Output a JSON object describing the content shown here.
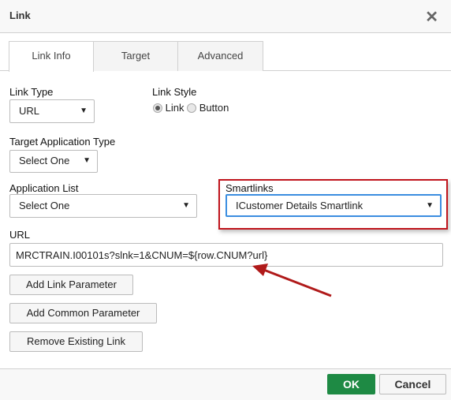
{
  "dialog": {
    "title": "Link"
  },
  "tabs": [
    {
      "label": "Link Info"
    },
    {
      "label": "Target"
    },
    {
      "label": "Advanced"
    }
  ],
  "link_type": {
    "label": "Link Type",
    "value": "URL"
  },
  "link_style": {
    "label": "Link Style",
    "options": [
      {
        "label": "Link",
        "selected": true
      },
      {
        "label": "Button",
        "selected": false
      }
    ]
  },
  "target_app_type": {
    "label": "Target Application Type",
    "value": "Select One"
  },
  "app_list": {
    "label": "Application List",
    "value": "Select One"
  },
  "smartlinks": {
    "label": "Smartlinks",
    "value": "ICustomer Details Smartlink"
  },
  "url": {
    "label": "URL",
    "value": "MRCTRAIN.I00101s?slnk=1&CNUM=${row.CNUM?url}"
  },
  "buttons": {
    "add_link_param": "Add Link Parameter",
    "add_common_param": "Add Common Parameter",
    "remove_link": "Remove Existing Link"
  },
  "footer": {
    "ok": "OK",
    "cancel": "Cancel"
  },
  "colors": {
    "ok": "#1e8a44",
    "highlight_box": "#c0141c",
    "focus": "#3b8de0"
  }
}
